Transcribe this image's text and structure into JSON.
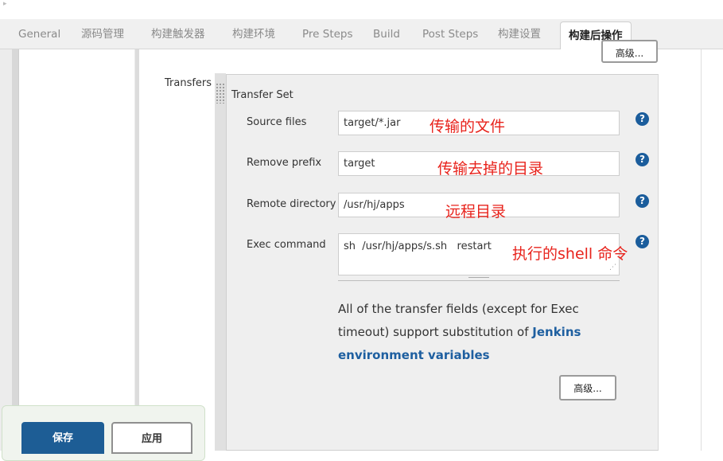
{
  "tabs": [
    {
      "label": "General"
    },
    {
      "label": "源码管理"
    },
    {
      "label": "构建触发器"
    },
    {
      "label": "构建环境"
    },
    {
      "label": "Pre Steps"
    },
    {
      "label": "Build"
    },
    {
      "label": "Post Steps"
    },
    {
      "label": "构建设置"
    },
    {
      "label": "构建后操作",
      "active": true
    }
  ],
  "advanced_top_label": "高级...",
  "transfers_label": "Transfers",
  "transfer_set_title": "Transfer Set",
  "fields": {
    "source_files": {
      "label": "Source files",
      "value": "target/*.jar"
    },
    "remove_prefix": {
      "label": "Remove prefix",
      "value": "target"
    },
    "remote_directory": {
      "label": "Remote directory",
      "value": "/usr/hj/apps"
    },
    "exec_command": {
      "label": "Exec command",
      "value": "sh  /usr/hj/apps/s.sh   restart"
    }
  },
  "help_icon_glyph": "?",
  "annotations": {
    "source_files": "传输的文件",
    "remove_prefix": "传输去掉的目录",
    "remote_directory": "远程目录",
    "exec_command": "执行的shell 命令"
  },
  "info": {
    "text": "All of the transfer fields (except for Exec timeout) support substitution of ",
    "link": "Jenkins environment variables"
  },
  "advanced_bottom_label": "高级...",
  "buttons": {
    "save": "保存",
    "apply": "应用"
  },
  "colors": {
    "primary_button": "#1d5d95",
    "help_icon": "#1b5d9c",
    "annotation": "#e8231c",
    "link": "#1e5fa0"
  }
}
